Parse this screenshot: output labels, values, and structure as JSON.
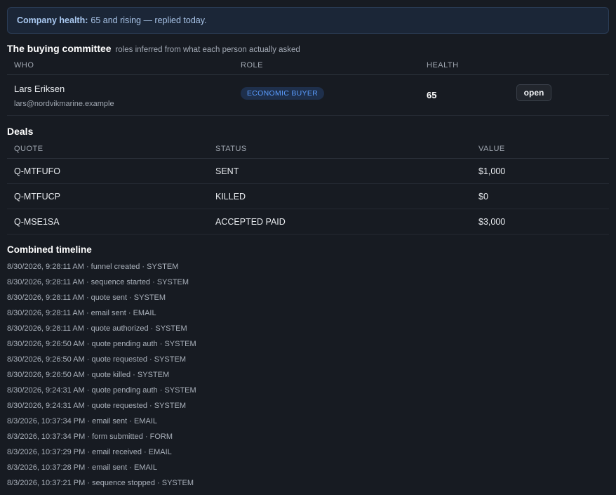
{
  "banner": {
    "label": "Company health:",
    "text": "65 and rising — replied today."
  },
  "committee": {
    "title": "The buying committee",
    "subtitle": "roles inferred from what each person actually asked",
    "columns": [
      "WHO",
      "ROLE",
      "HEALTH"
    ],
    "rows": [
      {
        "name": "Lars Eriksen",
        "email": "lars@nordvikmarine.example",
        "role": "ECONOMIC BUYER",
        "health": "65",
        "action": "open"
      }
    ]
  },
  "deals": {
    "title": "Deals",
    "columns": [
      "QUOTE",
      "STATUS",
      "VALUE"
    ],
    "rows": [
      {
        "quote": "Q-MTFUFO",
        "status": "SENT",
        "value": "$1,000"
      },
      {
        "quote": "Q-MTFUCP",
        "status": "KILLED",
        "value": "$0"
      },
      {
        "quote": "Q-MSE1SA",
        "status": "ACCEPTED PAID",
        "value": "$3,000"
      }
    ]
  },
  "timeline": {
    "title": "Combined timeline",
    "items": [
      "8/30/2026, 9:28:11 AM · funnel created · SYSTEM",
      "8/30/2026, 9:28:11 AM · sequence started · SYSTEM",
      "8/30/2026, 9:28:11 AM · quote sent · SYSTEM",
      "8/30/2026, 9:28:11 AM · email sent · EMAIL",
      "8/30/2026, 9:28:11 AM · quote authorized · SYSTEM",
      "8/30/2026, 9:26:50 AM · quote pending auth · SYSTEM",
      "8/30/2026, 9:26:50 AM · quote requested · SYSTEM",
      "8/30/2026, 9:26:50 AM · quote killed · SYSTEM",
      "8/30/2026, 9:24:31 AM · quote pending auth · SYSTEM",
      "8/30/2026, 9:24:31 AM · quote requested · SYSTEM",
      "8/3/2026, 10:37:34 PM · email sent · EMAIL",
      "8/3/2026, 10:37:34 PM · form submitted · FORM",
      "8/3/2026, 10:37:29 PM · email received · EMAIL",
      "8/3/2026, 10:37:28 PM · email sent · EMAIL",
      "8/3/2026, 10:37:21 PM · sequence stopped · SYSTEM"
    ]
  }
}
